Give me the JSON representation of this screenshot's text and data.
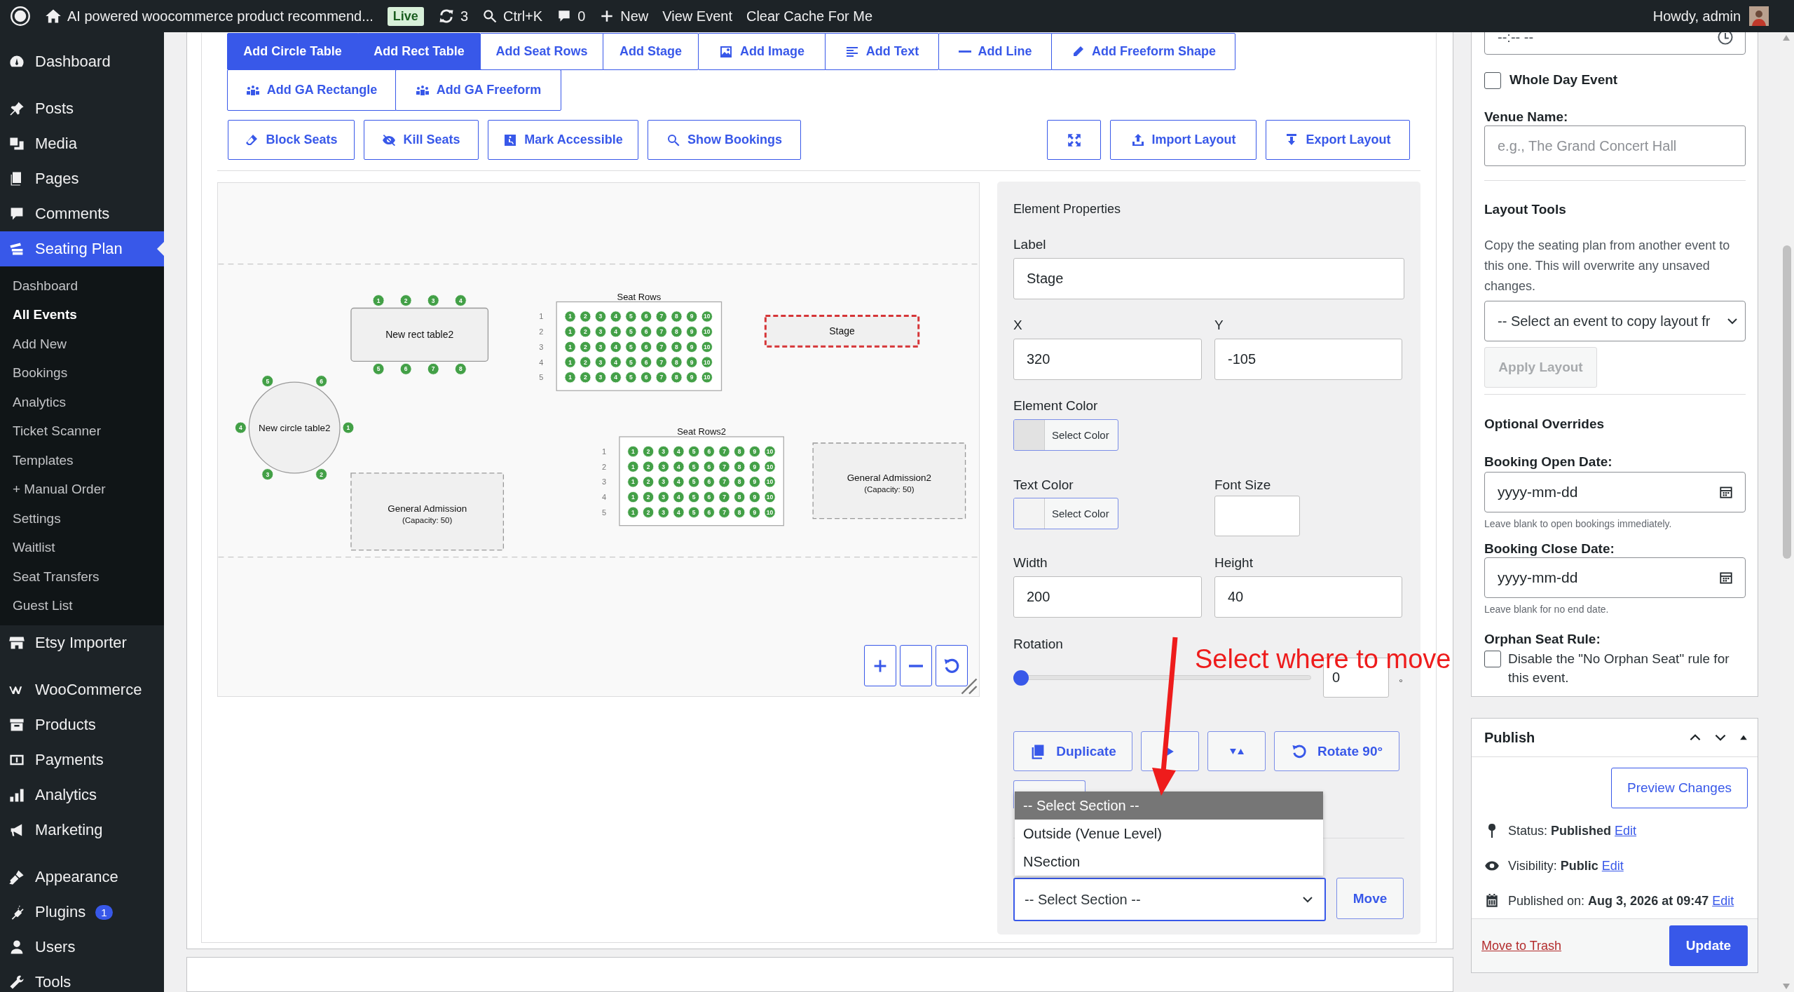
{
  "admin_bar": {
    "site_title": "AI powered woocommerce product recommend...",
    "live_badge": "Live",
    "updates": "3",
    "search_shortcut": "Ctrl+K",
    "comments": "0",
    "new_label": "New",
    "links": [
      "View Event",
      "Clear Cache For Me"
    ],
    "greeting": "Howdy, admin"
  },
  "sidebar": {
    "groups": [
      [
        {
          "label": "Dashboard",
          "selected": false
        }
      ],
      [
        {
          "label": "Posts",
          "selected": false
        },
        {
          "label": "Media",
          "selected": false
        },
        {
          "label": "Pages",
          "selected": false
        },
        {
          "label": "Comments",
          "selected": false
        },
        {
          "label": "Seating Plan",
          "selected": true,
          "children": [
            {
              "label": "Dashboard",
              "selected": false
            },
            {
              "label": "All Events",
              "selected": true
            },
            {
              "label": "Add New",
              "selected": false
            },
            {
              "label": "Bookings",
              "selected": false
            },
            {
              "label": "Analytics",
              "selected": false
            },
            {
              "label": "Ticket Scanner",
              "selected": false
            },
            {
              "label": "Templates",
              "selected": false
            },
            {
              "label": "+ Manual Order",
              "selected": false
            },
            {
              "label": "Settings",
              "selected": false
            },
            {
              "label": "Waitlist",
              "selected": false
            },
            {
              "label": "Seat Transfers",
              "selected": false
            },
            {
              "label": "Guest List",
              "selected": false
            }
          ]
        },
        {
          "label": "Etsy Importer",
          "selected": false
        }
      ],
      [
        {
          "label": "WooCommerce",
          "selected": false
        },
        {
          "label": "Products",
          "selected": false
        },
        {
          "label": "Payments",
          "selected": false
        },
        {
          "label": "Analytics",
          "selected": false
        },
        {
          "label": "Marketing",
          "selected": false
        }
      ],
      [
        {
          "label": "Appearance",
          "selected": false
        },
        {
          "label": "Plugins",
          "selected": false,
          "badge": "1"
        },
        {
          "label": "Users",
          "selected": false
        },
        {
          "label": "Tools",
          "selected": false
        }
      ]
    ]
  },
  "toolbar": {
    "add_rows": [
      [
        {
          "label": "Add Circle Table",
          "active": true
        },
        {
          "label": "Add Rect Table",
          "active": true
        },
        {
          "label": "Add Seat Rows",
          "active": false
        },
        {
          "label": "Add Stage",
          "active": false
        },
        {
          "label": "Add Image",
          "active": false
        },
        {
          "label": "Add Text",
          "active": false
        },
        {
          "label": "Add Line",
          "active": false
        },
        {
          "label": "Add Freeform Shape",
          "active": false
        }
      ],
      [
        {
          "label": "Add GA Rectangle",
          "active": false
        },
        {
          "label": "Add GA Freeform",
          "active": false
        }
      ]
    ],
    "tool_buttons": [
      "Block Seats",
      "Kill Seats",
      "Mark Accessible",
      "Show Bookings"
    ],
    "layout_buttons": [
      "Import Layout",
      "Export Layout"
    ]
  },
  "canvas": {
    "elements": [
      {
        "kind": "rect_table",
        "label": "New rect table2",
        "selected": false,
        "seats": [
          "1",
          "2",
          "3",
          "4",
          "5",
          "6",
          "7",
          "8"
        ]
      },
      {
        "kind": "seat_rows",
        "title": "Seat Rows",
        "selected": false,
        "rows": [
          {
            "label": "1",
            "seats": [
              "1",
              "2",
              "3",
              "4",
              "5",
              "6",
              "7",
              "8",
              "9",
              "10"
            ]
          },
          {
            "label": "2",
            "seats": [
              "1",
              "2",
              "3",
              "4",
              "5",
              "6",
              "7",
              "8",
              "9",
              "10"
            ]
          },
          {
            "label": "3",
            "seats": [
              "1",
              "2",
              "3",
              "4",
              "5",
              "6",
              "7",
              "8",
              "9",
              "10"
            ]
          },
          {
            "label": "4",
            "seats": [
              "1",
              "2",
              "3",
              "4",
              "5",
              "6",
              "7",
              "8",
              "9",
              "10"
            ]
          },
          {
            "label": "5",
            "seats": [
              "1",
              "2",
              "3",
              "4",
              "5",
              "6",
              "7",
              "8",
              "9",
              "10"
            ]
          }
        ]
      },
      {
        "kind": "stage",
        "label": "Stage",
        "selected": true
      },
      {
        "kind": "circle_table",
        "label": "New circle table2",
        "selected": false,
        "seats": [
          "1",
          "2",
          "3",
          "4",
          "5",
          "6"
        ]
      },
      {
        "kind": "ga_area",
        "label": "General Admission",
        "capacity": "(Capacity: 50)",
        "selected": false
      },
      {
        "kind": "seat_rows",
        "title": "Seat Rows2",
        "selected": false,
        "rows": [
          {
            "label": "1",
            "seats": [
              "1",
              "2",
              "3",
              "4",
              "5",
              "6",
              "7",
              "8",
              "9",
              "10"
            ]
          },
          {
            "label": "2",
            "seats": [
              "1",
              "2",
              "3",
              "4",
              "5",
              "6",
              "7",
              "8",
              "9",
              "10"
            ]
          },
          {
            "label": "3",
            "seats": [
              "1",
              "2",
              "3",
              "4",
              "5",
              "6",
              "7",
              "8",
              "9",
              "10"
            ]
          },
          {
            "label": "4",
            "seats": [
              "1",
              "2",
              "3",
              "4",
              "5",
              "6",
              "7",
              "8",
              "9",
              "10"
            ]
          },
          {
            "label": "5",
            "seats": [
              "1",
              "2",
              "3",
              "4",
              "5",
              "6",
              "7",
              "8",
              "9",
              "10"
            ]
          }
        ]
      },
      {
        "kind": "ga_area",
        "label": "General Admission2",
        "capacity": "(Capacity: 50)",
        "selected": false
      }
    ]
  },
  "properties": {
    "title": "Element Properties",
    "label": {
      "label": "Label",
      "value": "Stage"
    },
    "x": {
      "label": "X",
      "value": "320"
    },
    "y": {
      "label": "Y",
      "value": "-105"
    },
    "element_color": {
      "label": "Element Color",
      "button": "Select Color"
    },
    "text_color": {
      "label": "Text Color",
      "button": "Select Color"
    },
    "font_size": {
      "label": "Font Size"
    },
    "width": {
      "label": "Width",
      "value": "200"
    },
    "height": {
      "label": "Height",
      "value": "40"
    },
    "rotation": {
      "label": "Rotation",
      "level": 0,
      "value": "0",
      "unit": "°"
    },
    "actions": [
      {
        "kind": "labeled",
        "label": "Duplicate"
      },
      {
        "kind": "icon"
      },
      {
        "kind": "icon"
      },
      {
        "kind": "labeled",
        "label": "Rotate 90°"
      }
    ],
    "section_options": [
      {
        "label": "-- Select Section --",
        "selected": true
      },
      {
        "label": "Outside (Venue Level)",
        "selected": false
      },
      {
        "label": "NSection",
        "selected": false
      }
    ],
    "section_select": "-- Select Section --",
    "move_button": "Move"
  },
  "annotation": {
    "text": "Select where to move"
  },
  "event_box": {
    "time_placeholder": "--:-- --",
    "whole_day": {
      "label": "Whole Day Event",
      "checked": false
    },
    "venue": {
      "label": "Venue Name:",
      "placeholder": "e.g., The Grand Concert Hall"
    },
    "layout_tools": {
      "title": "Layout Tools",
      "description": "Copy the seating plan from another event to this one. This will overwrite any unsaved changes.",
      "select": "-- Select an event to copy layout fr",
      "button": "Apply Layout",
      "disabled": true
    },
    "overrides": {
      "title": "Optional Overrides",
      "dates": [
        {
          "label": "Booking Open Date:",
          "placeholder": "yyyy-mm-dd",
          "hint": "Leave blank to open bookings immediately."
        },
        {
          "label": "Booking Close Date:",
          "placeholder": "yyyy-mm-dd",
          "hint": "Leave blank for no end date."
        }
      ]
    },
    "orphan": {
      "label": "Orphan Seat Rule:",
      "checkbox_label": "Disable the \"No Orphan Seat\" rule for this event.",
      "checked": false
    }
  },
  "publish": {
    "title": "Publish",
    "preview_button": "Preview Changes",
    "meta": [
      {
        "text": "Status: **Published**",
        "link": "Edit"
      },
      {
        "text": "Visibility: **Public**",
        "link": "Edit"
      },
      {
        "text": "Published on: **Aug 3, 2026 at 09:47**",
        "link": "Edit"
      }
    ],
    "trash_link": "Move to Trash",
    "update_button": "Update"
  }
}
